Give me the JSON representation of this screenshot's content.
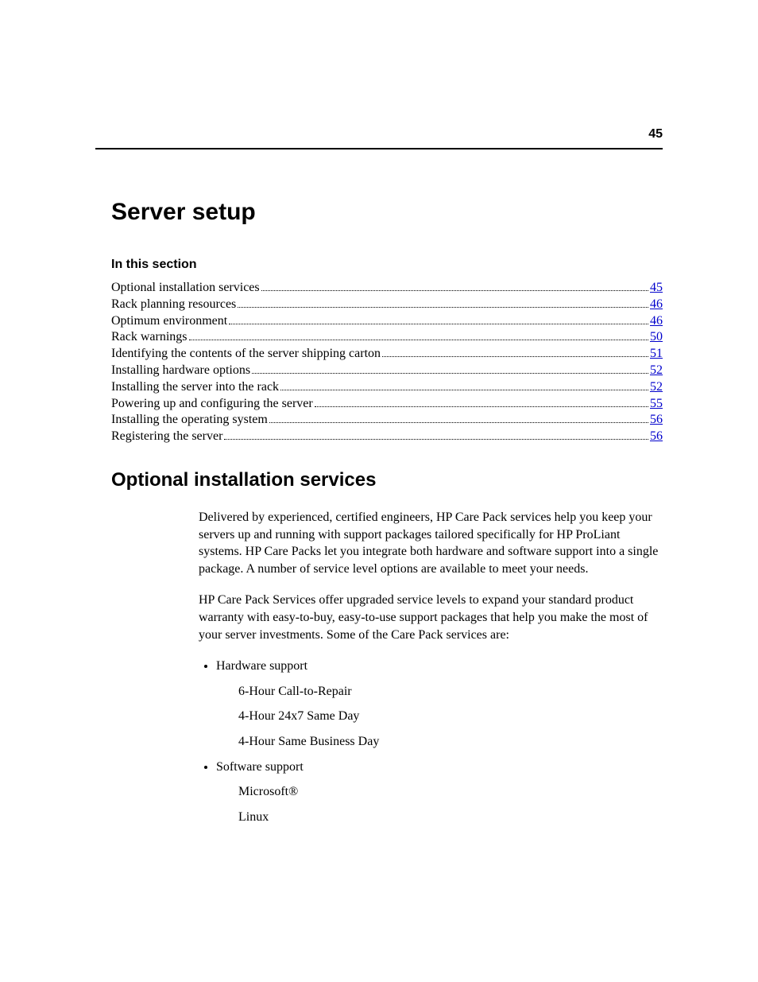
{
  "pageNumber": "45",
  "chapterTitle": "Server setup",
  "sectionLabel": "In this section",
  "toc": [
    {
      "label": "Optional installation services",
      "page": "45"
    },
    {
      "label": "Rack planning resources",
      "page": "46"
    },
    {
      "label": "Optimum environment",
      "page": "46"
    },
    {
      "label": "Rack warnings",
      "page": "50"
    },
    {
      "label": "Identifying the contents of the server shipping carton",
      "page": "51"
    },
    {
      "label": "Installing hardware options",
      "page": "52"
    },
    {
      "label": "Installing the server into the rack",
      "page": "52"
    },
    {
      "label": "Powering up and configuring the server",
      "page": "55"
    },
    {
      "label": "Installing the operating system",
      "page": "56"
    },
    {
      "label": "Registering the server",
      "page": "56"
    }
  ],
  "subheading": "Optional installation services",
  "para1": "Delivered by experienced, certified engineers, HP Care Pack services help you keep your servers up and running with support packages tailored specifically for HP ProLiant systems. HP Care Packs let you integrate both hardware and software support into a single package. A number of service level options are available to meet your needs.",
  "para2": "HP Care Pack Services offer upgraded service levels to expand your standard product warranty with easy-to-buy, easy-to-use support packages that help you make the most of your server investments. Some of the Care Pack services are:",
  "bullets": [
    {
      "label": "Hardware support",
      "items": [
        "6-Hour Call-to-Repair",
        "4-Hour 24x7 Same Day",
        "4-Hour Same Business Day"
      ]
    },
    {
      "label": "Software support",
      "items": [
        "Microsoft®",
        "Linux"
      ]
    }
  ]
}
